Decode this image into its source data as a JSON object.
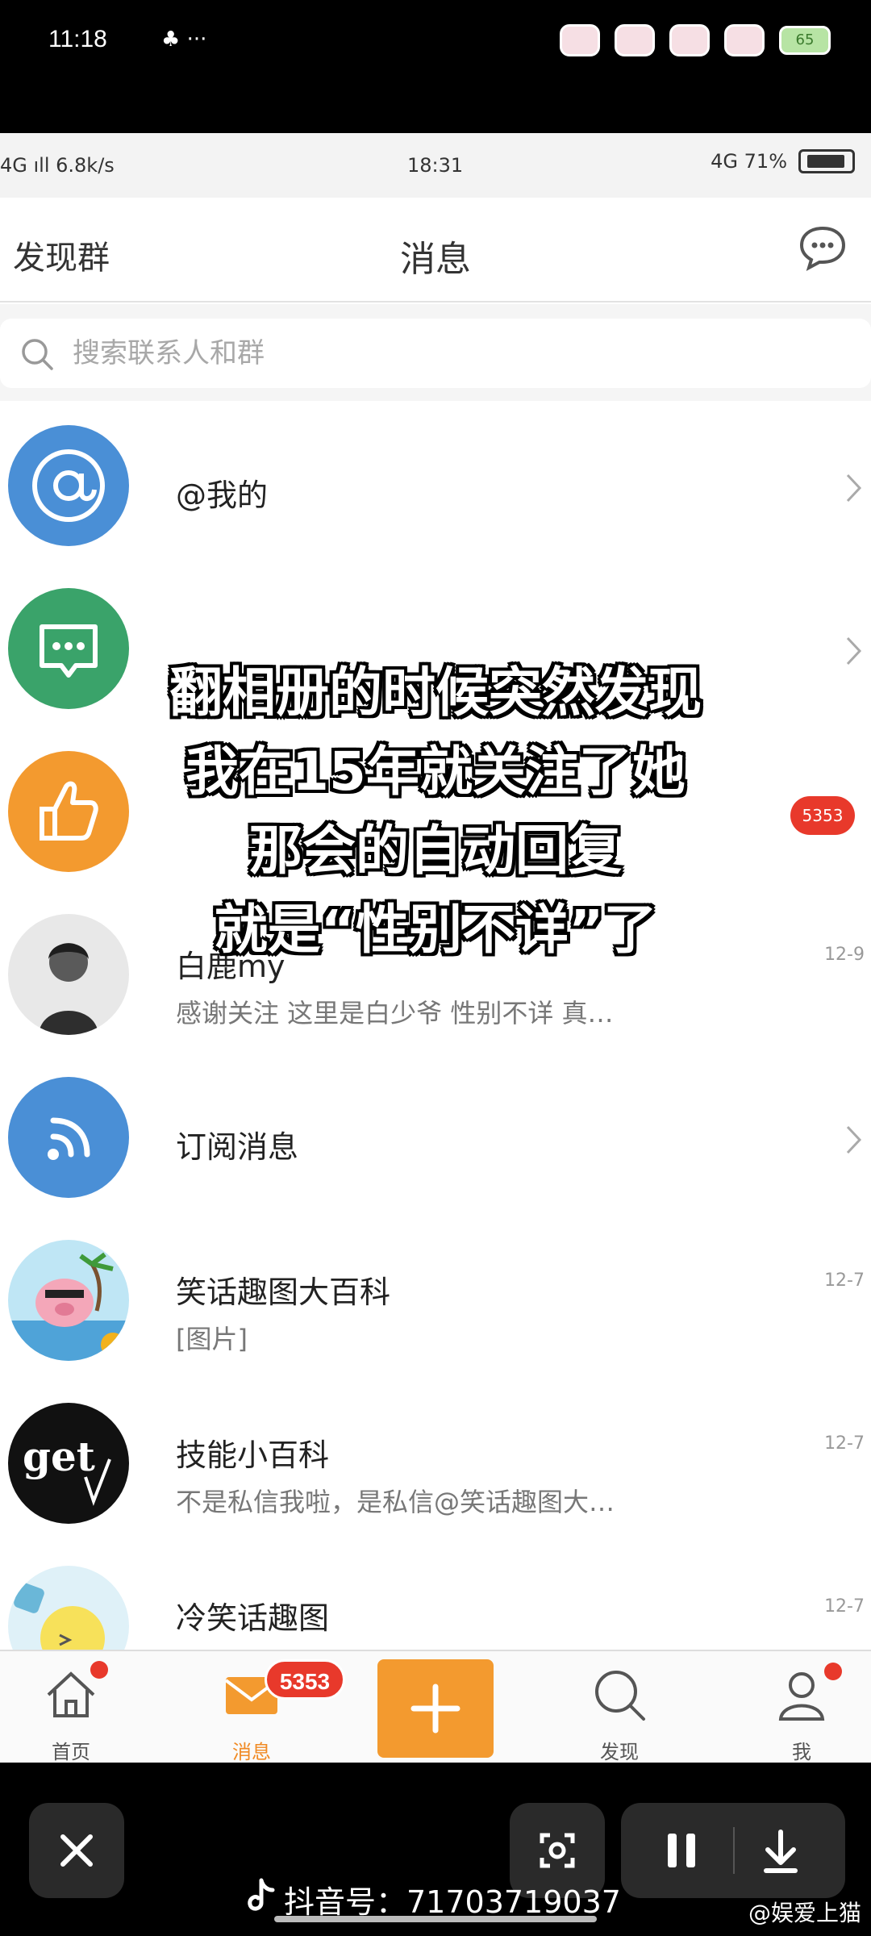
{
  "outer_status": {
    "time": "11:18",
    "icons": "♣ ···",
    "battery": "65"
  },
  "inner_status": {
    "left": "4G ıll  6.8k/s",
    "time": "18:31",
    "right": "4G  71%"
  },
  "header": {
    "left": "发现群",
    "title": "消息"
  },
  "search": {
    "placeholder": "搜索联系人和群"
  },
  "rows": [
    {
      "title": "@我的",
      "subtitle": "",
      "time": ""
    },
    {
      "title": "",
      "subtitle": "",
      "time": ""
    },
    {
      "title": "",
      "subtitle": "",
      "time": "",
      "badge": "5353"
    },
    {
      "title": "白鹿my",
      "subtitle": "感谢关注 这里是白少爷 性别不详 真…",
      "time": "12-9"
    },
    {
      "title": "订阅消息",
      "subtitle": "",
      "time": ""
    },
    {
      "title": "笑话趣图大百科",
      "subtitle": "[图片]",
      "time": "12-7"
    },
    {
      "title": "技能小百科",
      "subtitle": "不是私信我啦，是私信@笑话趣图大…",
      "time": "12-7"
    },
    {
      "title": "冷笑话趣图",
      "subtitle": "",
      "time": "12-7"
    }
  ],
  "caption": [
    "翻相册的时候突然发现",
    "我在15年就关注了她",
    "那会的自动回复",
    "就是“性别不详”了"
  ],
  "tabbar": {
    "home": "首页",
    "messages": "消息",
    "messages_badge": "5353",
    "discover": "发现",
    "me": "我"
  },
  "footer": {
    "douyin_id": "抖音号：71703719037",
    "watermark": "@娱爱上猫"
  },
  "colors": {
    "accent": "#f39a2f",
    "badge": "#e8392b",
    "blue": "#4a8fd6",
    "green": "#3aa36a"
  }
}
